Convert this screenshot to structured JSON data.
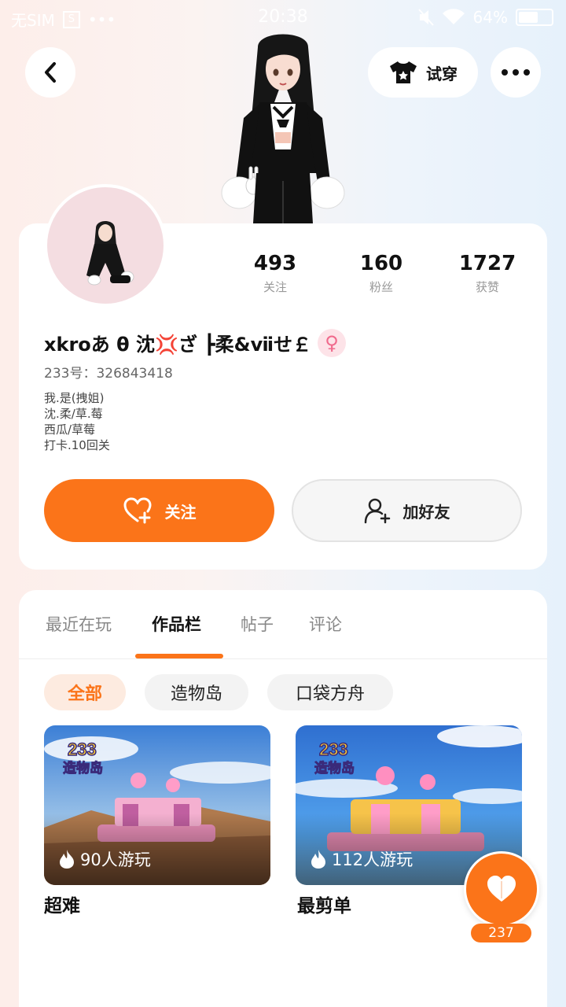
{
  "status_bar": {
    "sim": "无SIM",
    "sim_icon": "S",
    "dots": "•••",
    "time": "20:38",
    "battery": "64%",
    "battery_level": 0.64
  },
  "header": {
    "back_icon": "chevron-left-icon",
    "tryon_label": "试穿",
    "more_icon": "more-dots-icon"
  },
  "profile": {
    "nickname": "xkroあ θ 沈💢ざ ┣柔&ⅶせ￡",
    "gender_icon": "♀",
    "uid": "233号：326843418",
    "bio": [
      "我.是(拽姐)",
      "沈.柔/草.莓",
      "西瓜/草莓",
      "打卡.10回关"
    ],
    "stats": [
      {
        "value": "493",
        "label": "关注"
      },
      {
        "value": "160",
        "label": "粉丝"
      },
      {
        "value": "1727",
        "label": "获赞"
      }
    ],
    "follow_label": "关注",
    "add_friend_label": "加好友"
  },
  "tabs": [
    {
      "label": "最近在玩",
      "active": false
    },
    {
      "label": "作品栏",
      "active": true
    },
    {
      "label": "帖子",
      "active": false
    },
    {
      "label": "评论",
      "active": false
    }
  ],
  "filters": [
    {
      "label": "全部",
      "active": true
    },
    {
      "label": "造物岛",
      "active": false
    },
    {
      "label": "口袋方舟",
      "active": false
    }
  ],
  "works": [
    {
      "logo_top": "233",
      "logo_bottom": "造物岛",
      "plays": "90人游玩",
      "title": "超难"
    },
    {
      "logo_top": "233",
      "logo_bottom": "造物岛",
      "plays": "112人游玩",
      "title": "最剪单"
    }
  ],
  "like": {
    "icon": "heart-icon",
    "count": "237"
  },
  "colors": {
    "accent": "#fb7419",
    "chip_active_bg": "#fdebe0"
  }
}
